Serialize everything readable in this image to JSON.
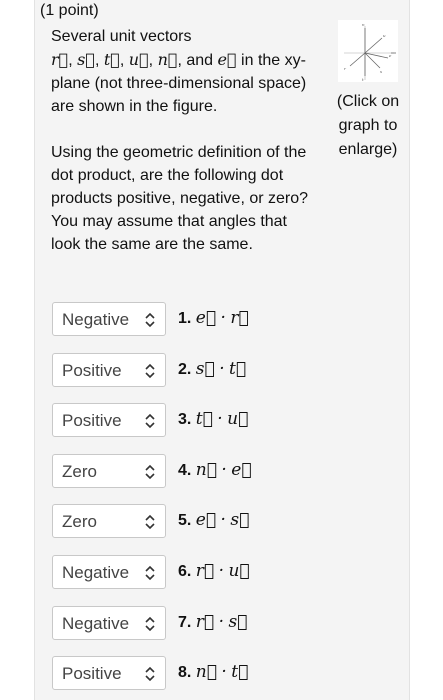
{
  "points": "(1 point)",
  "prompt": {
    "line1": "Several unit vectors",
    "vectors": [
      "r",
      "s",
      "t",
      "u",
      "n"
    ],
    "and_word": "and",
    "last_vector": "e",
    "tail": "in the xy-plane (not three-dimensional space) are shown in the figure.",
    "paragraph2": "Using the geometric definition of the dot product, are the following dot products positive, negative, or zero? You may assume that angles that look the same are the same."
  },
  "figure": {
    "caption": "(Click on graph to enlarge)",
    "labels": [
      "n",
      "u",
      "e",
      "r",
      "s",
      "t"
    ]
  },
  "questions": [
    {
      "selected": "Negative",
      "number": "1.",
      "a": "e",
      "b": "r"
    },
    {
      "selected": "Positive",
      "number": "2.",
      "a": "s",
      "b": "t"
    },
    {
      "selected": "Positive",
      "number": "3.",
      "a": "t",
      "b": "u"
    },
    {
      "selected": "Zero",
      "number": "4.",
      "a": "n",
      "b": "e"
    },
    {
      "selected": "Zero",
      "number": "5.",
      "a": "e",
      "b": "s"
    },
    {
      "selected": "Negative",
      "number": "6.",
      "a": "r",
      "b": "u"
    },
    {
      "selected": "Negative",
      "number": "7.",
      "a": "r",
      "b": "s"
    },
    {
      "selected": "Positive",
      "number": "8.",
      "a": "n",
      "b": "t"
    }
  ],
  "dot_symbol": "·",
  "chevron_icon": "updown-chevron-icon"
}
